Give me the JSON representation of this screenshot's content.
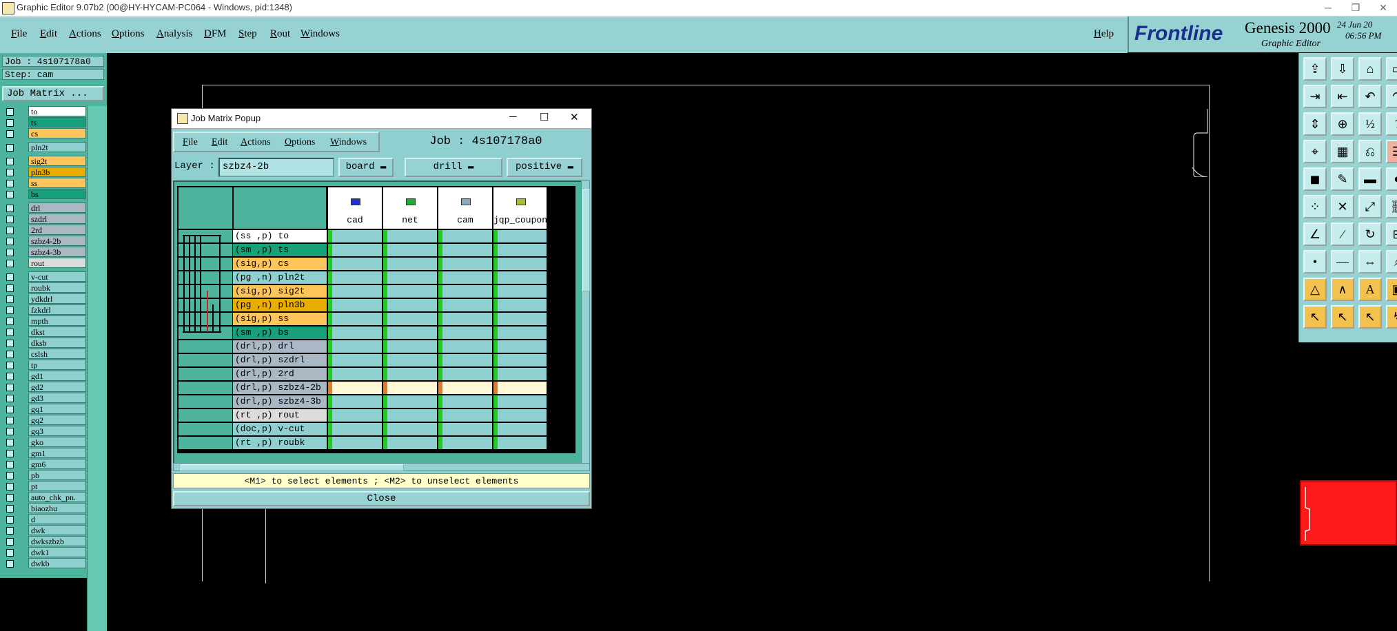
{
  "window": {
    "title": "Graphic Editor 9.07b2 (00@HY-HYCAM-PC064 - Windows, pid:1348)",
    "minimize": "─",
    "restore": "❐",
    "close": "✕"
  },
  "menu": [
    "File",
    "Edit",
    "Actions",
    "Options",
    "Analysis",
    "DFM",
    "Step",
    "Rout",
    "Windows"
  ],
  "help": "Help",
  "brand": {
    "logo": "Frontline",
    "product": "Genesis 2000",
    "subtitle": "Graphic Editor",
    "date": "24 Jun 20",
    "time": "06:56 PM"
  },
  "left_panel": {
    "job": "Job : 4s107178a0",
    "step": "Step: cam",
    "job_matrix_button": "Job Matrix ...",
    "layers": [
      {
        "name": "to",
        "color": "#ffffff"
      },
      {
        "name": "ts",
        "color": "#17a07a"
      },
      {
        "name": "cs",
        "color": "#ffc55a"
      },
      {
        "name": "pln2t",
        "color": "#8fcfcf",
        "gap": true
      },
      {
        "name": "sig2t",
        "color": "#ffc55a",
        "gap": true
      },
      {
        "name": "pln3b",
        "color": "#e8ad00"
      },
      {
        "name": "ss",
        "color": "#ffc55a"
      },
      {
        "name": "bs",
        "color": "#17a07a"
      },
      {
        "name": "drl",
        "color": "#aab8c6",
        "gap": true
      },
      {
        "name": "szdrl",
        "color": "#aab8c6"
      },
      {
        "name": "2rd",
        "color": "#aab8c6"
      },
      {
        "name": "szbz4-2b",
        "color": "#aab8c6"
      },
      {
        "name": "szbz4-3b",
        "color": "#aab8c6"
      },
      {
        "name": "rout",
        "color": "#dcdcdc"
      },
      {
        "name": "v-cut",
        "color": "#8fcfcf",
        "gap": true
      },
      {
        "name": "roubk",
        "color": "#8fcfcf"
      },
      {
        "name": "ydkdrl",
        "color": "#8fcfcf"
      },
      {
        "name": "fzkdrl",
        "color": "#8fcfcf"
      },
      {
        "name": "mpth",
        "color": "#8fcfcf"
      },
      {
        "name": "dkst",
        "color": "#8fcfcf"
      },
      {
        "name": "dksb",
        "color": "#8fcfcf"
      },
      {
        "name": "cslsh",
        "color": "#8fcfcf"
      },
      {
        "name": "tp",
        "color": "#8fcfcf"
      },
      {
        "name": "gd1",
        "color": "#8fcfcf"
      },
      {
        "name": "gd2",
        "color": "#8fcfcf"
      },
      {
        "name": "gd3",
        "color": "#8fcfcf"
      },
      {
        "name": "gq1",
        "color": "#8fcfcf"
      },
      {
        "name": "gq2",
        "color": "#8fcfcf"
      },
      {
        "name": "gq3",
        "color": "#8fcfcf"
      },
      {
        "name": "gko",
        "color": "#8fcfcf"
      },
      {
        "name": "gm1",
        "color": "#8fcfcf"
      },
      {
        "name": "gm6",
        "color": "#8fcfcf"
      },
      {
        "name": "pb",
        "color": "#8fcfcf"
      },
      {
        "name": "pt",
        "color": "#8fcfcf"
      },
      {
        "name": "auto_chk_pn.",
        "color": "#8fcfcf"
      },
      {
        "name": "biaozhu",
        "color": "#8fcfcf"
      },
      {
        "name": "d",
        "color": "#8fcfcf"
      },
      {
        "name": "dwk",
        "color": "#8fcfcf"
      },
      {
        "name": "dwkszbzb",
        "color": "#8fcfcf"
      },
      {
        "name": "dwk1",
        "color": "#8fcfcf"
      },
      {
        "name": "dwkb",
        "color": "#8fcfcf"
      }
    ]
  },
  "popup": {
    "title": "Job Matrix Popup",
    "menu": [
      "File",
      "Edit",
      "Actions",
      "Options",
      "Windows"
    ],
    "job": "Job : 4s107178a0",
    "layer_label": "Layer :",
    "layer_value": "szbz4-2b",
    "context": "board",
    "type": "drill",
    "polarity": "positive",
    "columns": [
      {
        "name": "cad",
        "icon_color": "#2233cc"
      },
      {
        "name": "net",
        "icon_color": "#22aa33"
      },
      {
        "name": "cam",
        "icon_color": "#88aabb"
      },
      {
        "name": "jqp_coupon",
        "icon_color": "#aabb33"
      }
    ],
    "rows": [
      {
        "label": "(ss ,p) to",
        "color": "#ffffff"
      },
      {
        "label": "(sm ,p) ts",
        "color": "#17a07a"
      },
      {
        "label": "(sig,p) cs",
        "color": "#ffc55a"
      },
      {
        "label": "(pg ,n) pln2t",
        "color": "#8fcfcf"
      },
      {
        "label": "(sig,p) sig2t",
        "color": "#ffc55a"
      },
      {
        "label": "(pg ,n) pln3b",
        "color": "#e8ad00"
      },
      {
        "label": "(sig,p) ss",
        "color": "#ffc55a"
      },
      {
        "label": "(sm ,p) bs",
        "color": "#17a07a"
      },
      {
        "label": "(drl,p) drl",
        "color": "#aab8c6"
      },
      {
        "label": "(drl,p) szdrl",
        "color": "#aab8c6"
      },
      {
        "label": "(drl,p) 2rd",
        "color": "#aab8c6"
      },
      {
        "label": "(drl,p) szbz4-2b",
        "color": "#aab8c6",
        "selected": true
      },
      {
        "label": "(drl,p) szbz4-3b",
        "color": "#aab8c6"
      },
      {
        "label": "(rt ,p) rout",
        "color": "#dcdcdc"
      },
      {
        "label": "(doc,p) v-cut",
        "color": "#8fcfcf"
      },
      {
        "label": "(rt ,p) roubk",
        "color": "#8fcfcf"
      }
    ],
    "hint": "<M1> to select elements ; <M2> to unselect elements",
    "close": "Close"
  },
  "toolbar_icons": [
    "import-icon",
    "export-icon",
    "home-icon",
    "frame-icon",
    "open-icon",
    "save-icon",
    "undo-icon",
    "redo-icon",
    "zoom-fit-icon",
    "zoom-icon",
    "ratio-icon",
    "help-icon",
    "snap-icon",
    "grid-icon",
    "net-icon",
    "layers-icon",
    "camera-icon",
    "edit-icon",
    "ruler-icon",
    "record-icon",
    "node-icon",
    "cross-icon",
    "connect-icon",
    "link-icon",
    "line-icon",
    "slash-icon",
    "arc-icon",
    "pad-icon",
    "pin-icon",
    "trace-icon",
    "measure-icon",
    "probe-icon",
    "triangle-icon",
    "angle-icon",
    "text-icon",
    "panel-icon",
    "pointer-icon",
    "select-icon",
    "pick-icon",
    "route-icon"
  ]
}
